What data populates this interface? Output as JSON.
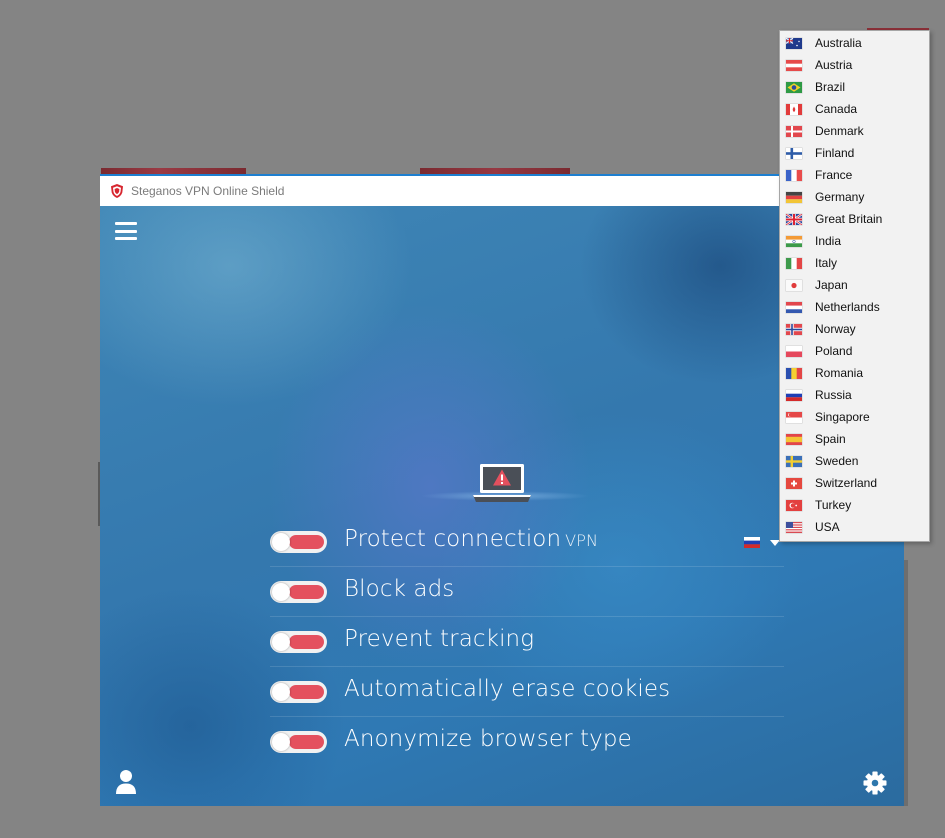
{
  "app": {
    "title": "Steganos VPN Online Shield"
  },
  "toggles": [
    {
      "label": "Protect connection",
      "suffix": "VPN",
      "enabled": false
    },
    {
      "label": "Block ads",
      "enabled": false
    },
    {
      "label": "Prevent tracking",
      "enabled": false
    },
    {
      "label": "Automatically erase cookies",
      "enabled": false
    },
    {
      "label": "Anonymize browser type",
      "enabled": false
    }
  ],
  "selected_country": {
    "flag_icon": "flag-russia-icon"
  },
  "countries": [
    {
      "label": "Australia",
      "flag": "au"
    },
    {
      "label": "Austria",
      "flag": "at"
    },
    {
      "label": "Brazil",
      "flag": "br"
    },
    {
      "label": "Canada",
      "flag": "ca"
    },
    {
      "label": "Denmark",
      "flag": "dk"
    },
    {
      "label": "Finland",
      "flag": "fi"
    },
    {
      "label": "France",
      "flag": "fr"
    },
    {
      "label": "Germany",
      "flag": "de"
    },
    {
      "label": "Great Britain",
      "flag": "gb"
    },
    {
      "label": "India",
      "flag": "in"
    },
    {
      "label": "Italy",
      "flag": "it"
    },
    {
      "label": "Japan",
      "flag": "jp"
    },
    {
      "label": "Netherlands",
      "flag": "nl"
    },
    {
      "label": "Norway",
      "flag": "no"
    },
    {
      "label": "Poland",
      "flag": "pl"
    },
    {
      "label": "Romania",
      "flag": "ro"
    },
    {
      "label": "Russia",
      "flag": "ru"
    },
    {
      "label": "Singapore",
      "flag": "sg"
    },
    {
      "label": "Spain",
      "flag": "es"
    },
    {
      "label": "Sweden",
      "flag": "se"
    },
    {
      "label": "Switzerland",
      "flag": "ch"
    },
    {
      "label": "Turkey",
      "flag": "tr"
    },
    {
      "label": "USA",
      "flag": "us"
    }
  ],
  "colors": {
    "toggle_off": "#e4505e",
    "window_accent": "#1d7fd0",
    "warning_red": "#e4505e"
  },
  "icons": {
    "menu": "hamburger-menu-icon",
    "status": "laptop-warning-icon",
    "user": "user-icon",
    "settings": "gear-icon"
  }
}
